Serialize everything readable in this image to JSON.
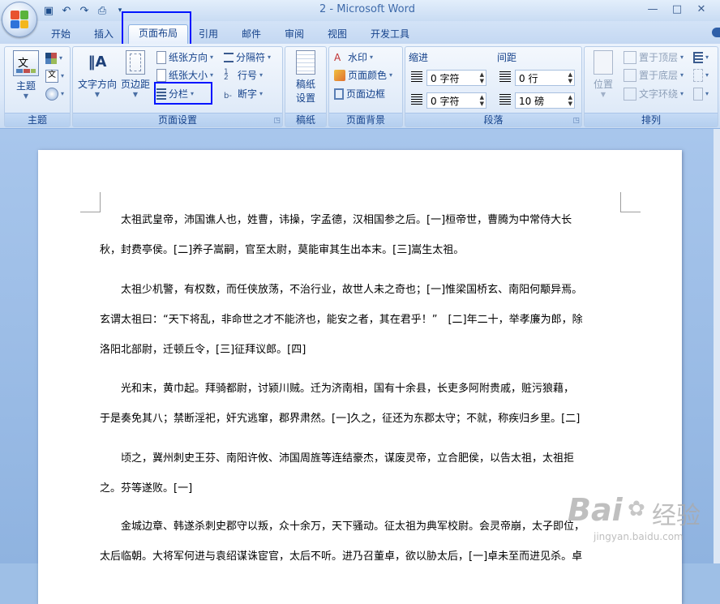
{
  "window": {
    "title": "2 - Microsoft Word",
    "controls": [
      "—",
      "□",
      "✕"
    ]
  },
  "qat": {
    "icons": [
      "save-icon",
      "undo-icon",
      "redo-icon",
      "print-preview-icon"
    ]
  },
  "tabs": [
    {
      "label": "开始"
    },
    {
      "label": "插入"
    },
    {
      "label": "页面布局"
    },
    {
      "label": "引用"
    },
    {
      "label": "邮件"
    },
    {
      "label": "审阅"
    },
    {
      "label": "视图"
    },
    {
      "label": "开发工具"
    }
  ],
  "active_tab": "页面布局",
  "ribbon": {
    "theme": {
      "label": "主题",
      "theme_button": "主题",
      "theme_caption": "文"
    },
    "page_setup": {
      "label": "页面设置",
      "text_direction": "文字方向",
      "margins": "页边距",
      "orientation": "纸张方向",
      "size": "纸张大小",
      "columns": "分栏",
      "breaks": "分隔符",
      "line_numbers": "行号",
      "hyphenation": "断字"
    },
    "paper": {
      "label": "稿纸",
      "button_line1": "稿纸",
      "button_line2": "设置"
    },
    "background": {
      "label": "页面背景",
      "watermark": "水印",
      "page_color": "页面颜色",
      "page_borders": "页面边框"
    },
    "paragraph": {
      "label": "段落",
      "indent_title": "缩进",
      "spacing_title": "间距",
      "indent_left": "0 字符",
      "indent_right": "0 字符",
      "spacing_before": "0 行",
      "spacing_after": "10 磅"
    },
    "arrange": {
      "label": "排列",
      "position": "位置",
      "bring_front": "置于顶层",
      "send_back": "置于底层",
      "text_wrap": "文字环绕"
    }
  },
  "document": {
    "paragraphs": [
      {
        "lines": [
          "太祖武皇帝，沛国谯人也，姓曹，讳操，字孟德，汉相国参之后。[一]桓帝世，曹腾为中常侍大长",
          "秋，封费亭侯。[二]养子嵩嗣，官至太尉，莫能审其生出本末。[三]嵩生太祖。"
        ]
      },
      {
        "lines": [
          "太祖少机警，有权数，而任侠放荡，不治行业，故世人未之奇也；[一]惟梁国桥玄、南阳何颙异焉。",
          "玄谓太祖曰：“天下将乱，非命世之才不能济也，能安之者，其在君乎！”　[二]年二十，举孝廉为郎，除",
          "洛阳北部尉，迁顿丘令，[三]征拜议郎。[四]"
        ]
      },
      {
        "lines": [
          "光和末，黄巾起。拜骑都尉，讨颍川贼。迁为济南相，国有十余县，长吏多阿附贵戚，赃污狼藉，",
          "于是奏免其八；禁断淫祀，奸宄逃窜，郡界肃然。[一]久之，征还为东郡太守；不就，称疾归乡里。[二]"
        ]
      },
      {
        "lines": [
          "顷之，冀州刺史王芬、南阳许攸、沛国周旌等连结豪杰，谋废灵帝，立合肥侯，以告太祖，太祖拒",
          "之。芬等遂败。[一]"
        ]
      },
      {
        "lines": [
          "金城边章、韩遂杀刺史郡守以叛，众十余万，天下骚动。征太祖为典军校尉。会灵帝崩，太子即位，",
          "太后临朝。大将军何进与袁绍谋诛宦官，太后不听。进乃召董卓，欲以胁太后，[一]卓未至而进见杀。卓"
        ]
      }
    ]
  },
  "watermark": {
    "brand": "Bai",
    "brand_cn": "经验",
    "url": "jingyan.baidu.com"
  },
  "colors": {
    "highlight": "#0015ff",
    "ribbon_text": "#15428b"
  }
}
